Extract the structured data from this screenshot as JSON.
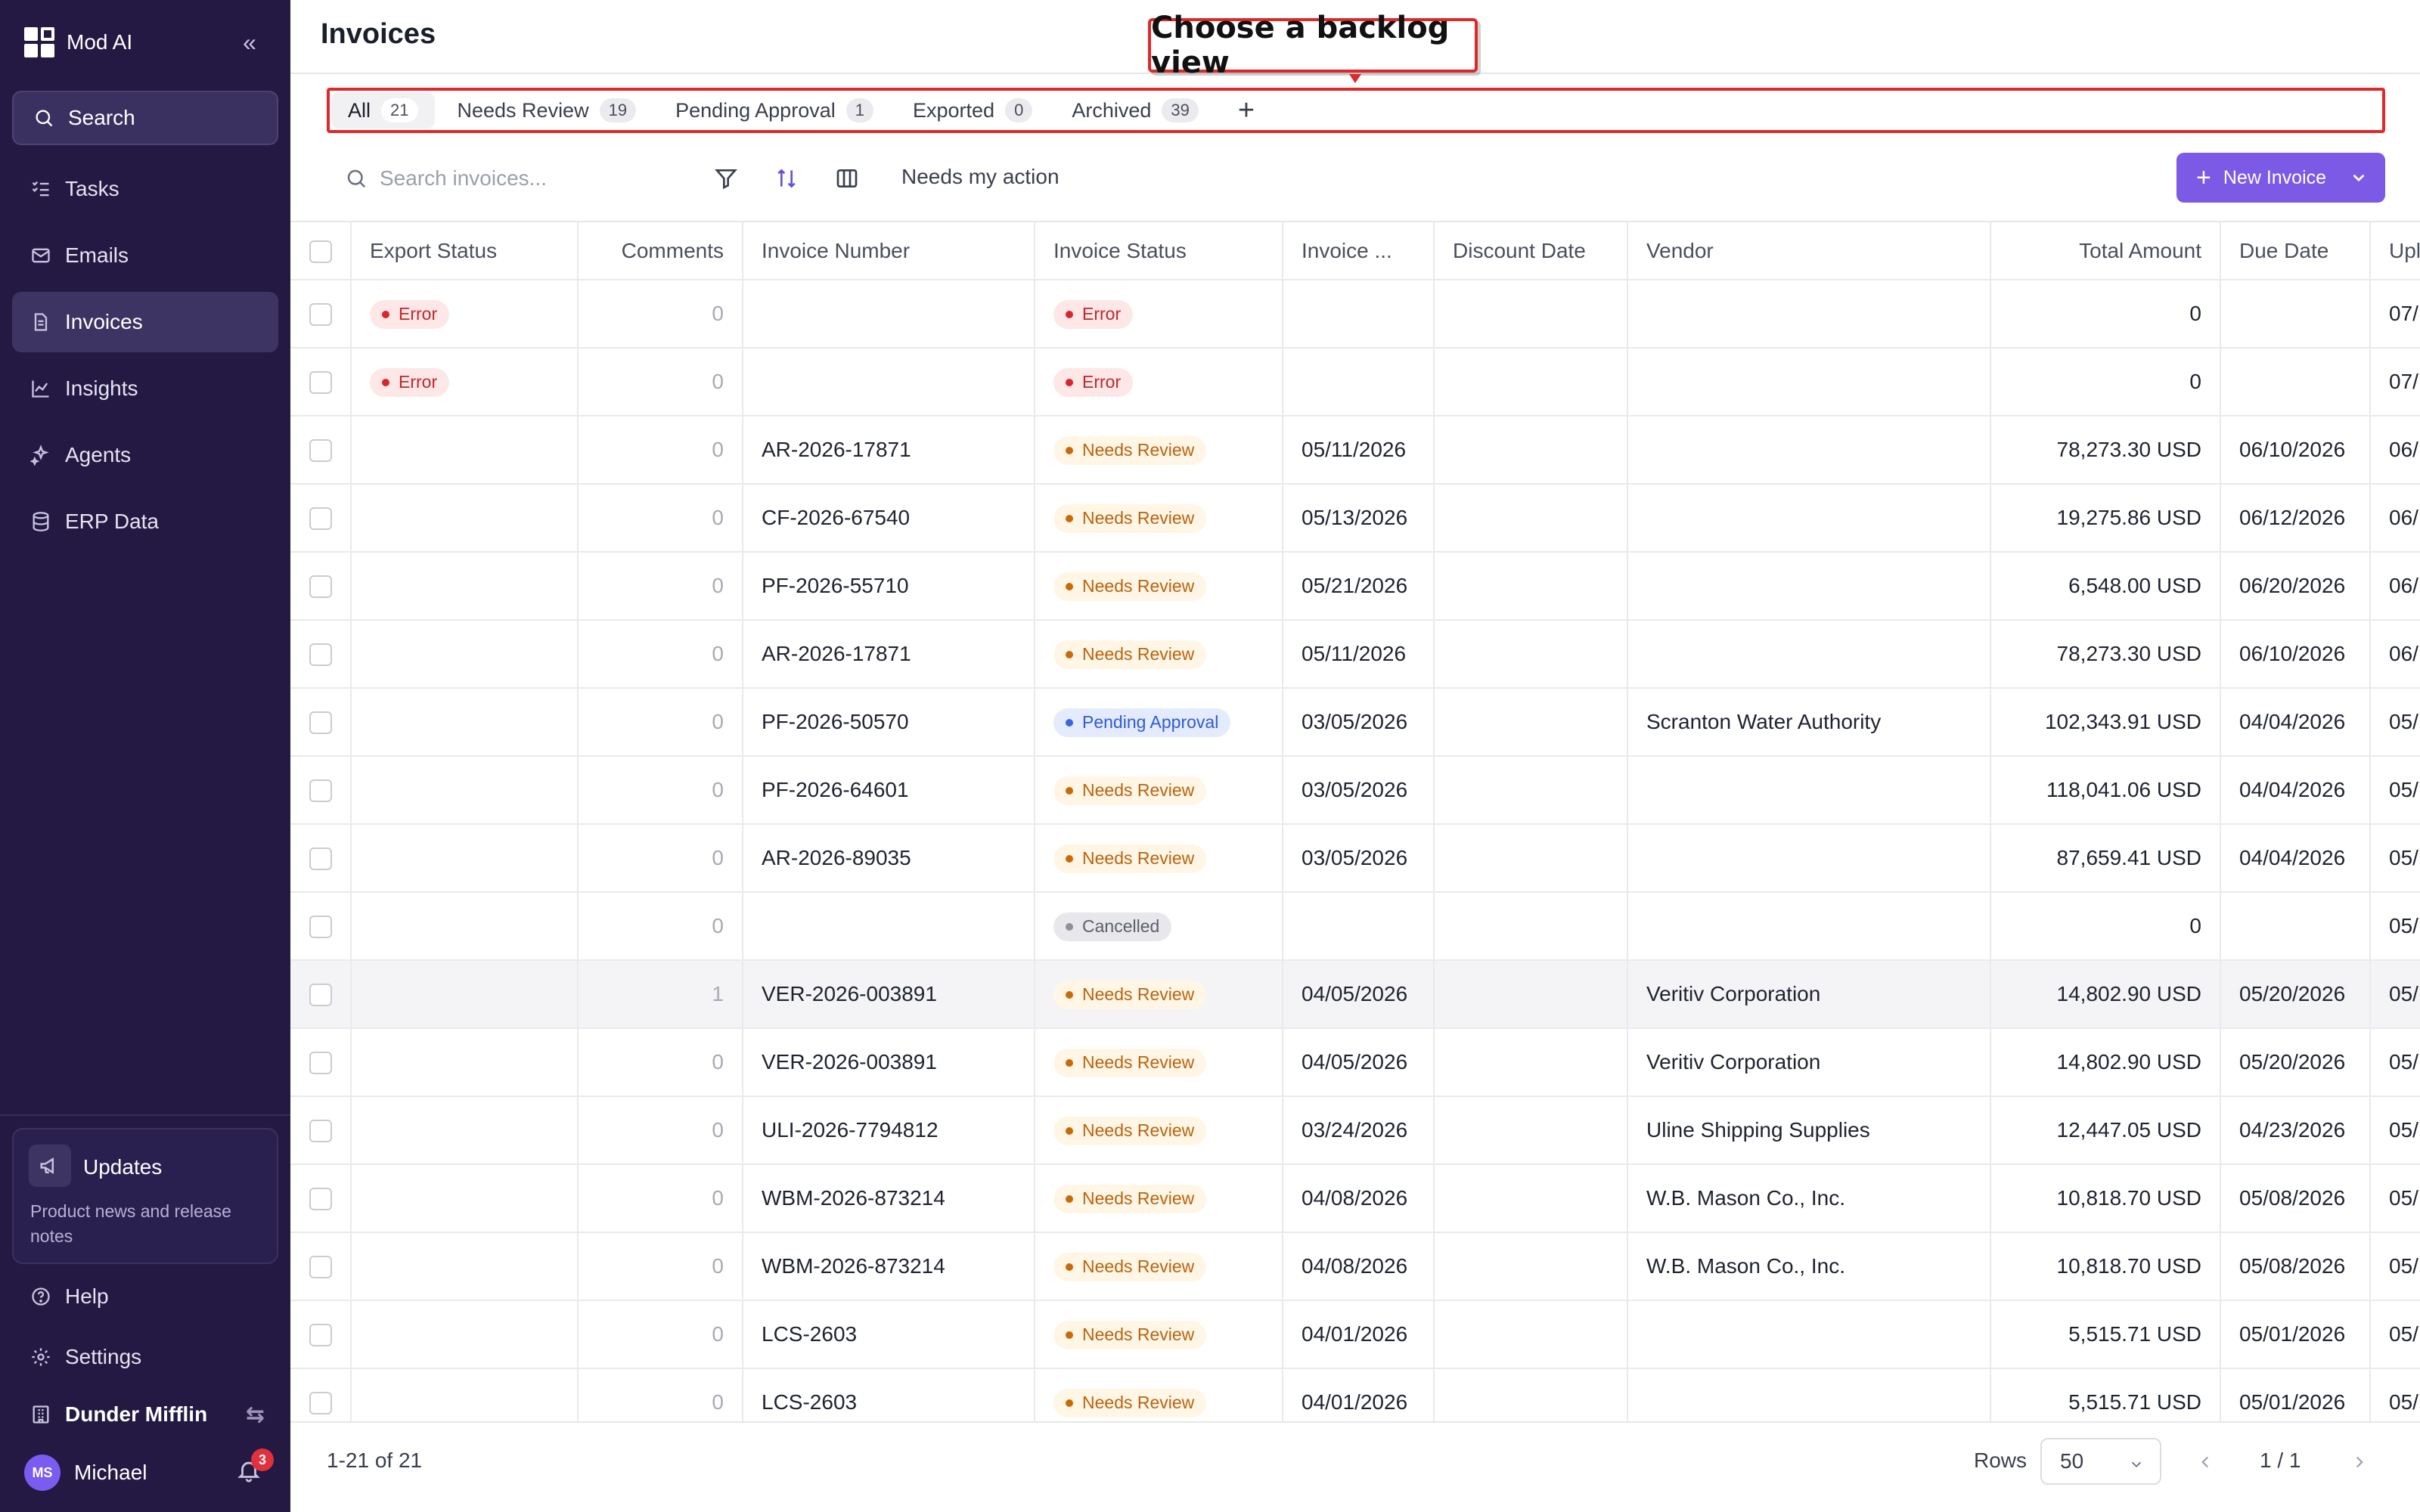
{
  "app": {
    "name": "Mod AI",
    "search_label": "Search"
  },
  "sidebar": {
    "items": [
      {
        "label": "Tasks",
        "icon": "tasks-icon",
        "active": false
      },
      {
        "label": "Emails",
        "icon": "mail-icon",
        "active": false
      },
      {
        "label": "Invoices",
        "icon": "document-icon",
        "active": true
      },
      {
        "label": "Insights",
        "icon": "chart-line-icon",
        "active": false
      },
      {
        "label": "Agents",
        "icon": "sparkles-icon",
        "active": false
      },
      {
        "label": "ERP Data",
        "icon": "database-icon",
        "active": false
      }
    ],
    "updates": {
      "title": "Updates",
      "subtitle": "Product news and release notes"
    },
    "help": "Help",
    "settings": "Settings",
    "org": "Dunder Mifflin",
    "user": {
      "initials": "MS",
      "name": "Michael",
      "notifications": "3"
    }
  },
  "page": {
    "title": "Invoices",
    "callout": "Choose a backlog view"
  },
  "tabs": [
    {
      "label": "All",
      "count": "21",
      "active": true
    },
    {
      "label": "Needs Review",
      "count": "19",
      "active": false
    },
    {
      "label": "Pending Approval",
      "count": "1",
      "active": false
    },
    {
      "label": "Exported",
      "count": "0",
      "active": false
    },
    {
      "label": "Archived",
      "count": "39",
      "active": false
    }
  ],
  "toolbar": {
    "search_placeholder": "Search invoices...",
    "quick_filter": "Needs my action",
    "new_button": "New Invoice"
  },
  "table": {
    "columns": [
      "Export Status",
      "Comments",
      "Invoice Number",
      "Invoice Status",
      "Invoice ...",
      "Discount Date",
      "Vendor",
      "Total Amount",
      "Due Date",
      "Upl"
    ],
    "rows": [
      {
        "export": "Error",
        "comments": "0",
        "number": "",
        "status": "Error",
        "invoice_date": "",
        "discount": "",
        "vendor": "",
        "total": "0",
        "due": "",
        "upload": "07/",
        "highlight": false
      },
      {
        "export": "Error",
        "comments": "0",
        "number": "",
        "status": "Error",
        "invoice_date": "",
        "discount": "",
        "vendor": "",
        "total": "0",
        "due": "",
        "upload": "07/",
        "highlight": false
      },
      {
        "export": "",
        "comments": "0",
        "number": "AR-2026-17871",
        "status": "Needs Review",
        "invoice_date": "05/11/2026",
        "discount": "",
        "vendor": "",
        "total": "78,273.30 USD",
        "due": "06/10/2026",
        "upload": "06/",
        "highlight": false
      },
      {
        "export": "",
        "comments": "0",
        "number": "CF-2026-67540",
        "status": "Needs Review",
        "invoice_date": "05/13/2026",
        "discount": "",
        "vendor": "",
        "total": "19,275.86 USD",
        "due": "06/12/2026",
        "upload": "06/",
        "highlight": false
      },
      {
        "export": "",
        "comments": "0",
        "number": "PF-2026-55710",
        "status": "Needs Review",
        "invoice_date": "05/21/2026",
        "discount": "",
        "vendor": "",
        "total": "6,548.00 USD",
        "due": "06/20/2026",
        "upload": "06/",
        "highlight": false
      },
      {
        "export": "",
        "comments": "0",
        "number": "AR-2026-17871",
        "status": "Needs Review",
        "invoice_date": "05/11/2026",
        "discount": "",
        "vendor": "",
        "total": "78,273.30 USD",
        "due": "06/10/2026",
        "upload": "06/",
        "highlight": false
      },
      {
        "export": "",
        "comments": "0",
        "number": "PF-2026-50570",
        "status": "Pending Approval",
        "invoice_date": "03/05/2026",
        "discount": "",
        "vendor": "Scranton Water Authority",
        "total": "102,343.91 USD",
        "due": "04/04/2026",
        "upload": "05/",
        "highlight": false
      },
      {
        "export": "",
        "comments": "0",
        "number": "PF-2026-64601",
        "status": "Needs Review",
        "invoice_date": "03/05/2026",
        "discount": "",
        "vendor": "",
        "total": "118,041.06 USD",
        "due": "04/04/2026",
        "upload": "05/",
        "highlight": false
      },
      {
        "export": "",
        "comments": "0",
        "number": "AR-2026-89035",
        "status": "Needs Review",
        "invoice_date": "03/05/2026",
        "discount": "",
        "vendor": "",
        "total": "87,659.41 USD",
        "due": "04/04/2026",
        "upload": "05/",
        "highlight": false
      },
      {
        "export": "",
        "comments": "0",
        "number": "",
        "status": "Cancelled",
        "invoice_date": "",
        "discount": "",
        "vendor": "",
        "total": "0",
        "due": "",
        "upload": "05/",
        "highlight": false
      },
      {
        "export": "",
        "comments": "1",
        "number": "VER-2026-003891",
        "status": "Needs Review",
        "invoice_date": "04/05/2026",
        "discount": "",
        "vendor": "Veritiv Corporation",
        "total": "14,802.90 USD",
        "due": "05/20/2026",
        "upload": "05/",
        "highlight": true
      },
      {
        "export": "",
        "comments": "0",
        "number": "VER-2026-003891",
        "status": "Needs Review",
        "invoice_date": "04/05/2026",
        "discount": "",
        "vendor": "Veritiv Corporation",
        "total": "14,802.90 USD",
        "due": "05/20/2026",
        "upload": "05/",
        "highlight": false
      },
      {
        "export": "",
        "comments": "0",
        "number": "ULI-2026-7794812",
        "status": "Needs Review",
        "invoice_date": "03/24/2026",
        "discount": "",
        "vendor": "Uline Shipping Supplies",
        "total": "12,447.05 USD",
        "due": "04/23/2026",
        "upload": "05/",
        "highlight": false
      },
      {
        "export": "",
        "comments": "0",
        "number": "WBM-2026-873214",
        "status": "Needs Review",
        "invoice_date": "04/08/2026",
        "discount": "",
        "vendor": "W.B. Mason Co., Inc.",
        "total": "10,818.70 USD",
        "due": "05/08/2026",
        "upload": "05/",
        "highlight": false
      },
      {
        "export": "",
        "comments": "0",
        "number": "WBM-2026-873214",
        "status": "Needs Review",
        "invoice_date": "04/08/2026",
        "discount": "",
        "vendor": "W.B. Mason Co., Inc.",
        "total": "10,818.70 USD",
        "due": "05/08/2026",
        "upload": "05/",
        "highlight": false
      },
      {
        "export": "",
        "comments": "0",
        "number": "LCS-2603",
        "status": "Needs Review",
        "invoice_date": "04/01/2026",
        "discount": "",
        "vendor": "",
        "total": "5,515.71 USD",
        "due": "05/01/2026",
        "upload": "05/",
        "highlight": false
      },
      {
        "export": "",
        "comments": "0",
        "number": "LCS-2603",
        "status": "Needs Review",
        "invoice_date": "04/01/2026",
        "discount": "",
        "vendor": "",
        "total": "5,515.71 USD",
        "due": "05/01/2026",
        "upload": "05/",
        "highlight": false
      }
    ]
  },
  "footer": {
    "range": "1-21 of 21",
    "rows_label": "Rows",
    "rows_value": "50",
    "page_info": "1 / 1"
  },
  "colors": {
    "sidebar_bg": "#231942",
    "accent": "#7c5ae6",
    "annotation_red": "#e02828"
  }
}
